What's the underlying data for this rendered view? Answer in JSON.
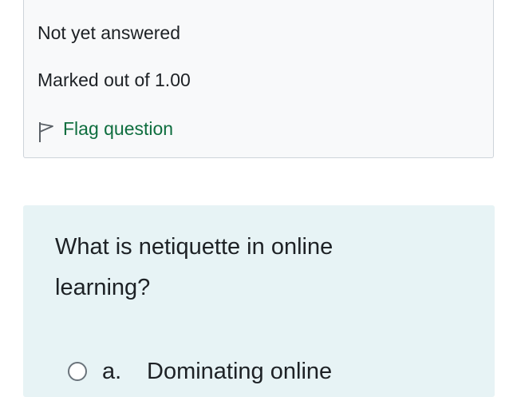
{
  "question_info": {
    "state": "Not yet answered",
    "grade": "Marked out of 1.00",
    "flag_label": "Flag question",
    "flag_icon": "flag-outline-icon"
  },
  "question": {
    "text": "What is netiquette in online learning?",
    "answers": [
      {
        "letter": "a.",
        "text": "Dominating online"
      }
    ]
  },
  "colors": {
    "info_background": "#f8f9fa",
    "info_border": "#ced4da",
    "question_background": "#e7f3f5",
    "link_green": "#0f6e3f",
    "text": "#1d2125"
  }
}
